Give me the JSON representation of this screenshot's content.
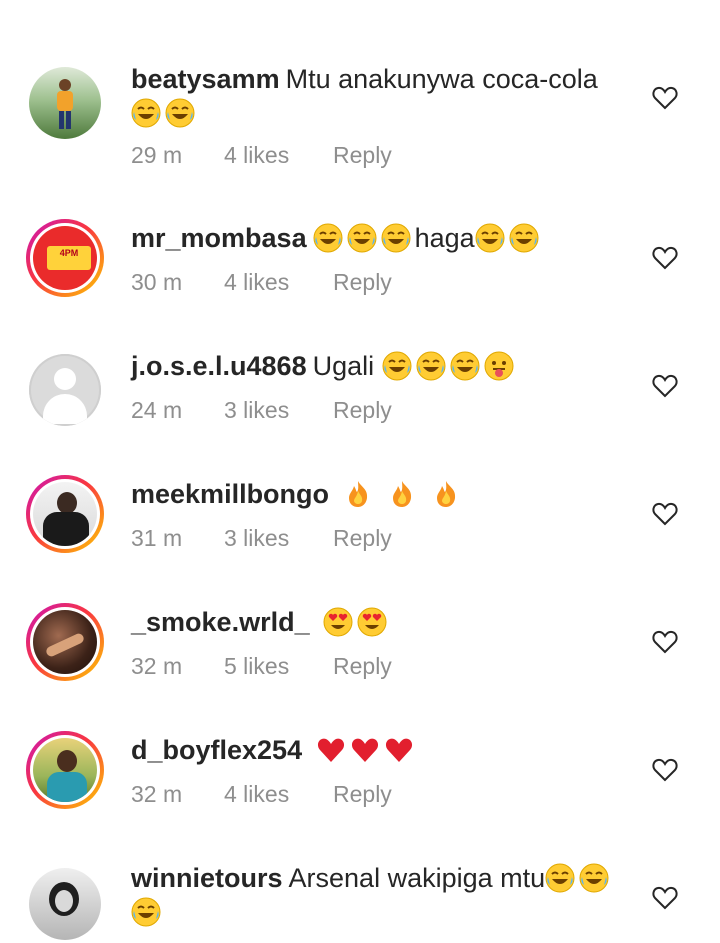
{
  "comments": [
    {
      "username": "beatysamm",
      "text": "Mtu anakunywa coca-cola",
      "emojis": "😂😂",
      "time": "29 m",
      "likes": "4 likes",
      "reply": "Reply"
    },
    {
      "username": "mr_mombasa",
      "text_before": "",
      "emojis_before": "😂😂😂",
      "text": "haga",
      "emojis": "😂😂",
      "time": "30 m",
      "likes": "4 likes",
      "reply": "Reply",
      "avatar_text": "4PM"
    },
    {
      "username": "j.o.s.e.l.u4868",
      "text": "Ugali",
      "emojis": "😂😂😂😛",
      "time": "24 m",
      "likes": "3 likes",
      "reply": "Reply"
    },
    {
      "username": "meekmillbongo",
      "text": "",
      "emojis": "🔥🔥🔥",
      "time": "31 m",
      "likes": "3 likes",
      "reply": "Reply"
    },
    {
      "username": "_smoke.wrld_",
      "text": "",
      "emojis": "😍😍",
      "time": "32 m",
      "likes": "5 likes",
      "reply": "Reply"
    },
    {
      "username": "d_boyflex254",
      "text": "",
      "emojis": "❤️❤️❤️",
      "time": "32 m",
      "likes": "4 likes",
      "reply": "Reply"
    },
    {
      "username": "winnietours",
      "text": "Arsenal wakipiga mtu",
      "emojis": "😂😂😂",
      "time": "",
      "likes": "",
      "reply": ""
    }
  ],
  "colors": {
    "username": "#262626",
    "meta": "#8e8e8e",
    "ring_start": "#c913b9",
    "ring_end": "#fecd00"
  }
}
